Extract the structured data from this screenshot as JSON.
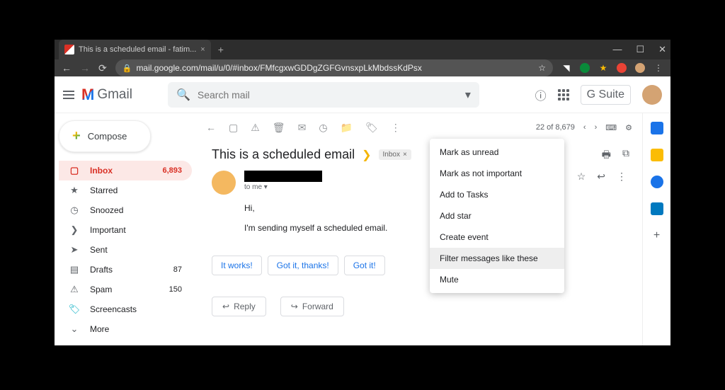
{
  "browser": {
    "tab_title": "This is a scheduled email - fatim...",
    "url": "mail.google.com/mail/u/0/#inbox/FMfcgxwGDDgZGFGvnsxpLkMbdssKdPsx"
  },
  "header": {
    "logo": "Gmail",
    "search_placeholder": "Search mail",
    "gsuite": "G Suite"
  },
  "compose_label": "Compose",
  "sidebar": {
    "items": [
      {
        "label": "Inbox",
        "count": "6,893"
      },
      {
        "label": "Starred",
        "count": ""
      },
      {
        "label": "Snoozed",
        "count": ""
      },
      {
        "label": "Important",
        "count": ""
      },
      {
        "label": "Sent",
        "count": ""
      },
      {
        "label": "Drafts",
        "count": "87"
      },
      {
        "label": "Spam",
        "count": "150"
      },
      {
        "label": "Screencasts",
        "count": ""
      },
      {
        "label": "More",
        "count": ""
      }
    ]
  },
  "toolbar": {
    "pager": "22 of 8,679"
  },
  "email": {
    "subject": "This is a scheduled email",
    "label": "Inbox",
    "to_line": "to me",
    "body_line1": "Hi,",
    "body_line2": "I'm sending myself a scheduled email.",
    "smart_replies": [
      "It works!",
      "Got it, thanks!",
      "Got it!"
    ],
    "reply": "Reply",
    "forward": "Forward"
  },
  "menu": {
    "items": [
      "Mark as unread",
      "Mark as not important",
      "Add to Tasks",
      "Add star",
      "Create event",
      "Filter messages like these",
      "Mute"
    ]
  }
}
